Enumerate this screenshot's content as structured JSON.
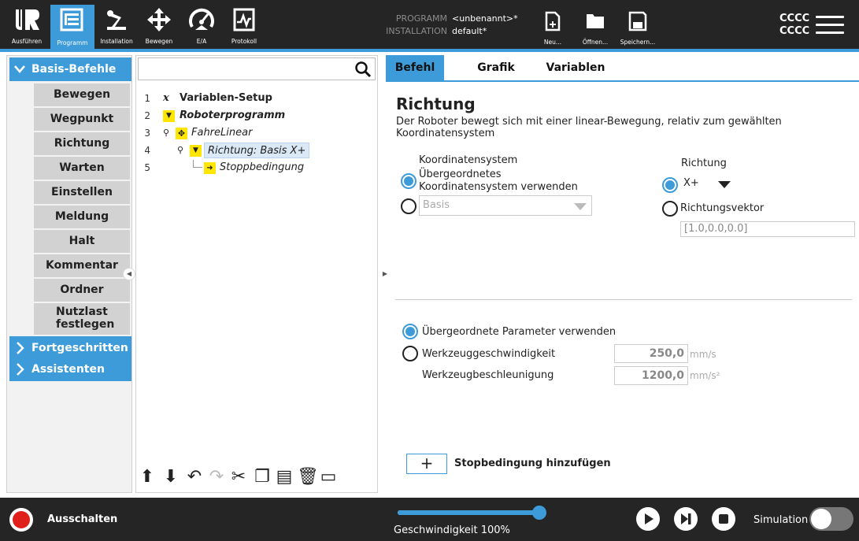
{
  "topnav": {
    "items": [
      {
        "label": "Ausführen",
        "icon": "ur-logo-icon"
      },
      {
        "label": "Programm",
        "icon": "program-tree-icon"
      },
      {
        "label": "Installation",
        "icon": "robot-arm-icon"
      },
      {
        "label": "Bewegen",
        "icon": "move-arrows-icon"
      },
      {
        "label": "E/A",
        "icon": "io-gauge-icon"
      },
      {
        "label": "Protokoll",
        "icon": "log-chart-icon"
      }
    ],
    "active": "Programm"
  },
  "program_info": {
    "program_key": "PROGRAMM",
    "program_value": "<unbenannt>*",
    "installation_key": "INSTALLATION",
    "installation_value": "default*"
  },
  "file_actions": {
    "new": "Neu...",
    "open": "Öffnen...",
    "save": "Speichern..."
  },
  "user": {
    "line1": "CCCC",
    "line2": "CCCC"
  },
  "sidebar": {
    "basic_header": "Basis-Befehle",
    "items": [
      "Bewegen",
      "Wegpunkt",
      "Richtung",
      "Warten",
      "Einstellen",
      "Meldung",
      "Halt",
      "Kommentar",
      "Ordner",
      "Nutzlast festlegen"
    ],
    "advanced_header": "Fortgeschritten",
    "wizards_header": "Assistenten"
  },
  "tree": {
    "search_placeholder": "",
    "rows": [
      {
        "num": "1",
        "label": "Variablen-Setup"
      },
      {
        "num": "2",
        "label": "Roboterprogramm"
      },
      {
        "num": "3",
        "label": "FahreLinear"
      },
      {
        "num": "4",
        "label": "Richtung: Basis X+"
      },
      {
        "num": "5",
        "label": "Stoppbedingung"
      }
    ]
  },
  "tabs": [
    "Befehl",
    "Grafik",
    "Variablen"
  ],
  "direction": {
    "title": "Richtung",
    "description": "Der Roboter bewegt sich mit einer linear-Bewegung, relativ zum gewählten Koordinatensystem",
    "coord_label": "Koordinatensystem",
    "coord_option_parent_line1": "Übergeordnetes",
    "coord_option_parent_line2": "Koordinatensystem verwenden",
    "coord_dropdown_value": "Basis",
    "dir_label": "Richtung",
    "dir_dropdown_value": "X+",
    "dir_vector_label": "Richtungsvektor",
    "dir_vector_value": "[1.0,0.0,0.0]",
    "param_parent_label": "Übergeordnete Parameter verwenden",
    "tool_speed_label": "Werkzeuggeschwindigkeit",
    "tool_speed_value": "250,0",
    "tool_speed_unit": "mm/s",
    "tool_accel_label": "Werkzeugbeschleunigung",
    "tool_accel_value": "1200,0",
    "tool_accel_unit": "mm/s²",
    "add_stop_symbol": "+",
    "add_stop_label": "Stopbedingung hinzufügen"
  },
  "bottom": {
    "power_label": "Ausschalten",
    "speed_label": "Geschwindigkeit 100%",
    "speed_fraction": 1.0,
    "simulation_label": "Simulation"
  },
  "colors": {
    "accent": "#3d9bd9",
    "bar": "#252525",
    "power": "#e0201b"
  }
}
